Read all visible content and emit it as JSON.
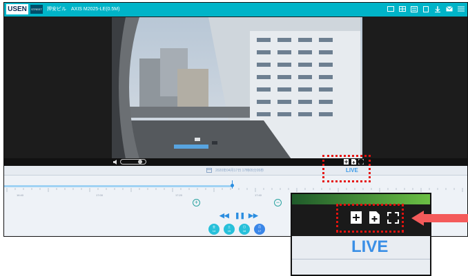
{
  "header": {
    "logo": "USEN",
    "logo_sub": "STREET",
    "camera_title": "押安ビル　AXIS M2025-LE(0.5M)",
    "icons": [
      "single-view-icon",
      "grid-view-icon",
      "list-view-icon",
      "fullscreen-icon",
      "download-icon",
      "mail-icon",
      "menu-icon"
    ]
  },
  "video": {
    "controls": [
      "snapshot-icon",
      "clip-icon",
      "fullscreen-icon"
    ]
  },
  "panel": {
    "date_text": "2020年04月17日 17時05分05秒",
    "live_label": "LIVE",
    "playhead_progress": 0.49,
    "times": [
      "16:40",
      "17:00",
      "17:20",
      "17:40",
      "18:00"
    ],
    "zoom_in": "+",
    "zoom_out": "−",
    "rewind": "◀◀",
    "pause": "❚❚",
    "forward": "▶▶",
    "days": [
      {
        "weekday": "金",
        "day": "14"
      },
      {
        "weekday": "土",
        "day": "15"
      },
      {
        "weekday": "日",
        "day": "16"
      },
      {
        "weekday": "月",
        "day": "17"
      }
    ]
  },
  "callout": {
    "live_label": "LIVE",
    "accent_color": "#e5120e",
    "arrow_color": "#f45a5a"
  }
}
